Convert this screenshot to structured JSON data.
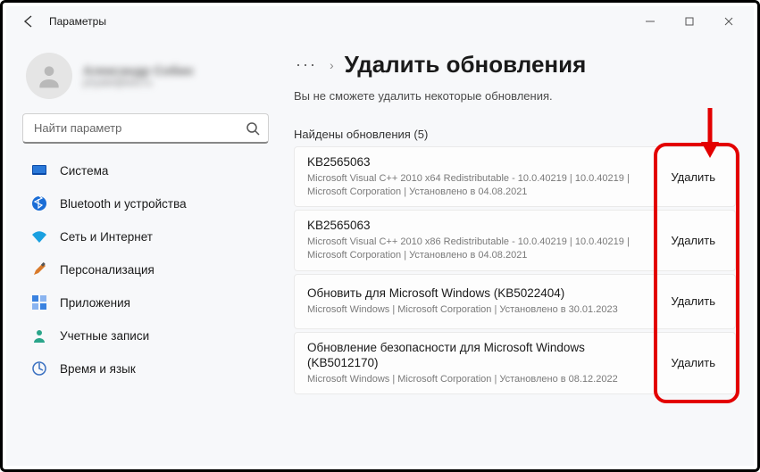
{
  "window": {
    "title": "Параметры"
  },
  "profile": {
    "name": "Александр Собин",
    "email": "priyatel@test.ru"
  },
  "search": {
    "placeholder": "Найти параметр"
  },
  "sidebar": {
    "items": [
      {
        "label": "Система"
      },
      {
        "label": "Bluetooth и устройства"
      },
      {
        "label": "Сеть и Интернет"
      },
      {
        "label": "Персонализация"
      },
      {
        "label": "Приложения"
      },
      {
        "label": "Учетные записи"
      },
      {
        "label": "Время и язык"
      }
    ]
  },
  "breadcrumb": {
    "dots": "···",
    "title": "Удалить обновления"
  },
  "subtitle": "Вы не сможете удалить некоторые обновления.",
  "section_header": "Найдены обновления (5)",
  "uninstall_label": "Удалить",
  "updates": [
    {
      "title": "KB2565063",
      "meta": "Microsoft Visual C++ 2010  x64 Redistributable - 10.0.40219   |   10.0.40219   |   Microsoft Corporation   |   Установлено в 04.08.2021"
    },
    {
      "title": "KB2565063",
      "meta": "Microsoft Visual C++ 2010  x86 Redistributable - 10.0.40219   |   10.0.40219   |   Microsoft Corporation   |   Установлено в 04.08.2021"
    },
    {
      "title": "Обновить для Microsoft Windows (KB5022404)",
      "meta": "Microsoft Windows   |   Microsoft Corporation   |   Установлено в 30.01.2023"
    },
    {
      "title": "Обновление безопасности для Microsoft Windows (KB5012170)",
      "meta": "Microsoft Windows   |   Microsoft Corporation   |   Установлено в 08.12.2022"
    }
  ]
}
